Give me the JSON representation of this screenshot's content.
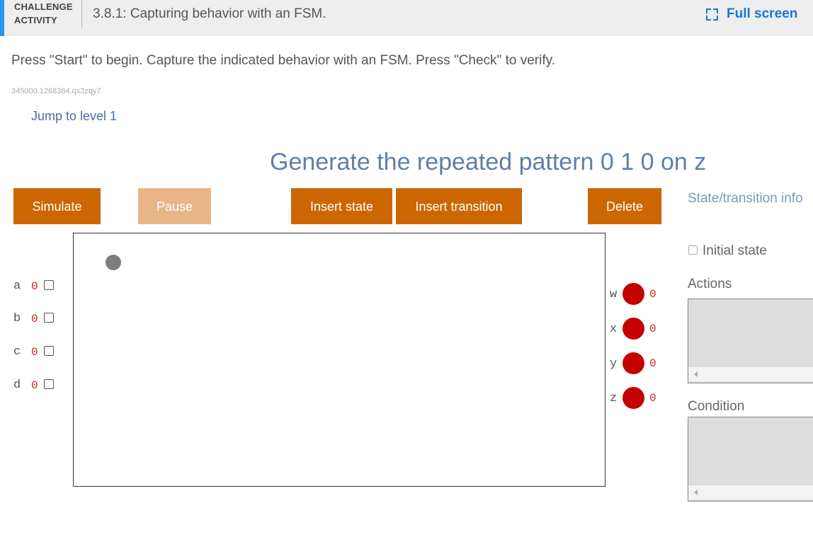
{
  "header": {
    "badge_line1": "CHALLENGE",
    "badge_line2": "ACTIVITY",
    "title": "3.8.1: Capturing behavior with an FSM.",
    "fullscreen_label": "Full screen",
    "accent_color": "#2196f3"
  },
  "instructions": "Press \"Start\" to begin. Capture the indicated behavior with an FSM. Press \"Check\" to verify.",
  "activity_id": "345000.1268384.qx3zqy7",
  "jump_link": "Jump to level 1",
  "prompt": "Generate the repeated pattern 0 1 0 on z",
  "toolbar": {
    "simulate": "Simulate",
    "pause": "Pause",
    "insert_state": "Insert state",
    "insert_transition": "Insert transition",
    "delete": "Delete",
    "button_color": "#cc6600",
    "disabled_color": "#e8b587"
  },
  "inputs": [
    {
      "name": "a",
      "value": "0"
    },
    {
      "name": "b",
      "value": "0"
    },
    {
      "name": "c",
      "value": "0"
    },
    {
      "name": "d",
      "value": "0"
    }
  ],
  "outputs": [
    {
      "name": "w",
      "value": "0"
    },
    {
      "name": "x",
      "value": "0"
    },
    {
      "name": "y",
      "value": "0"
    },
    {
      "name": "z",
      "value": "0"
    }
  ],
  "side_panel": {
    "title": "State/transition info",
    "initial_state_label": "Initial state",
    "actions_label": "Actions",
    "condition_label": "Condition"
  }
}
